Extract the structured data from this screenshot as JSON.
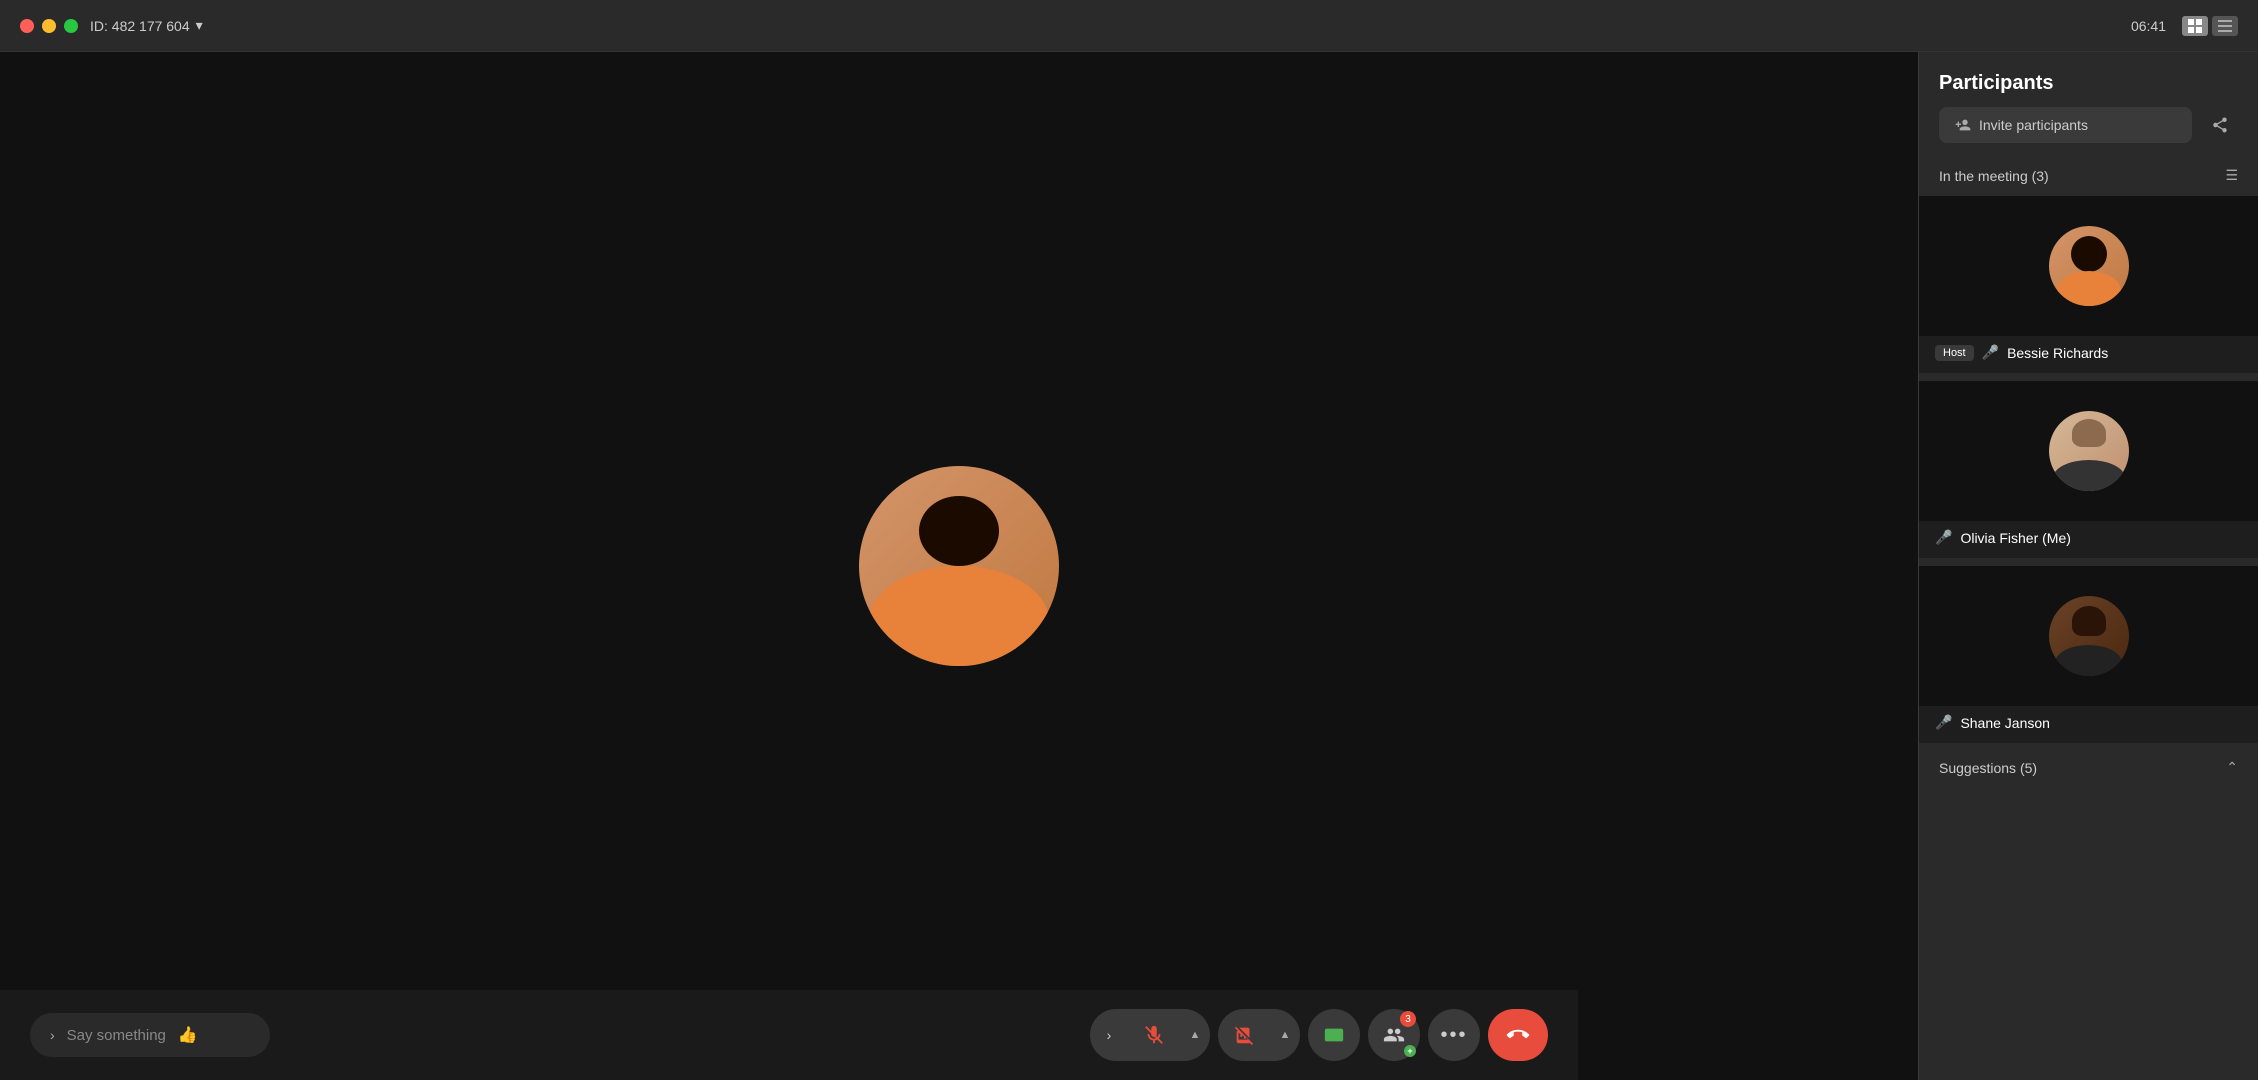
{
  "titlebar": {
    "meeting_id": "ID: 482 177 604",
    "dropdown_icon": "▾",
    "time": "06:41",
    "close_label": "✕",
    "minimize_label": "−",
    "maximize_label": "□"
  },
  "video_area": {
    "main_participant_name": "Bessie Richards"
  },
  "bottom_bar": {
    "chat_placeholder": "Say something",
    "thumbs_up": "👍",
    "expand_label": "›",
    "mute_caret": "›",
    "video_caret": "›",
    "participants_count": "3",
    "more_label": "•••",
    "end_call_icon": "📞"
  },
  "participants_panel": {
    "title": "Participants",
    "invite_label": "Invite participants",
    "in_meeting_label": "In the meeting (3)",
    "suggestions_label": "Suggestions (5)",
    "participants": [
      {
        "name": "Bessie Richards",
        "is_host": true,
        "is_muted": true,
        "avatar_type": "bessie"
      },
      {
        "name": "Olivia Fisher (Me)",
        "is_host": false,
        "is_muted": true,
        "avatar_type": "olivia"
      },
      {
        "name": "Shane Janson",
        "is_host": false,
        "is_muted": true,
        "avatar_type": "shane"
      }
    ]
  }
}
